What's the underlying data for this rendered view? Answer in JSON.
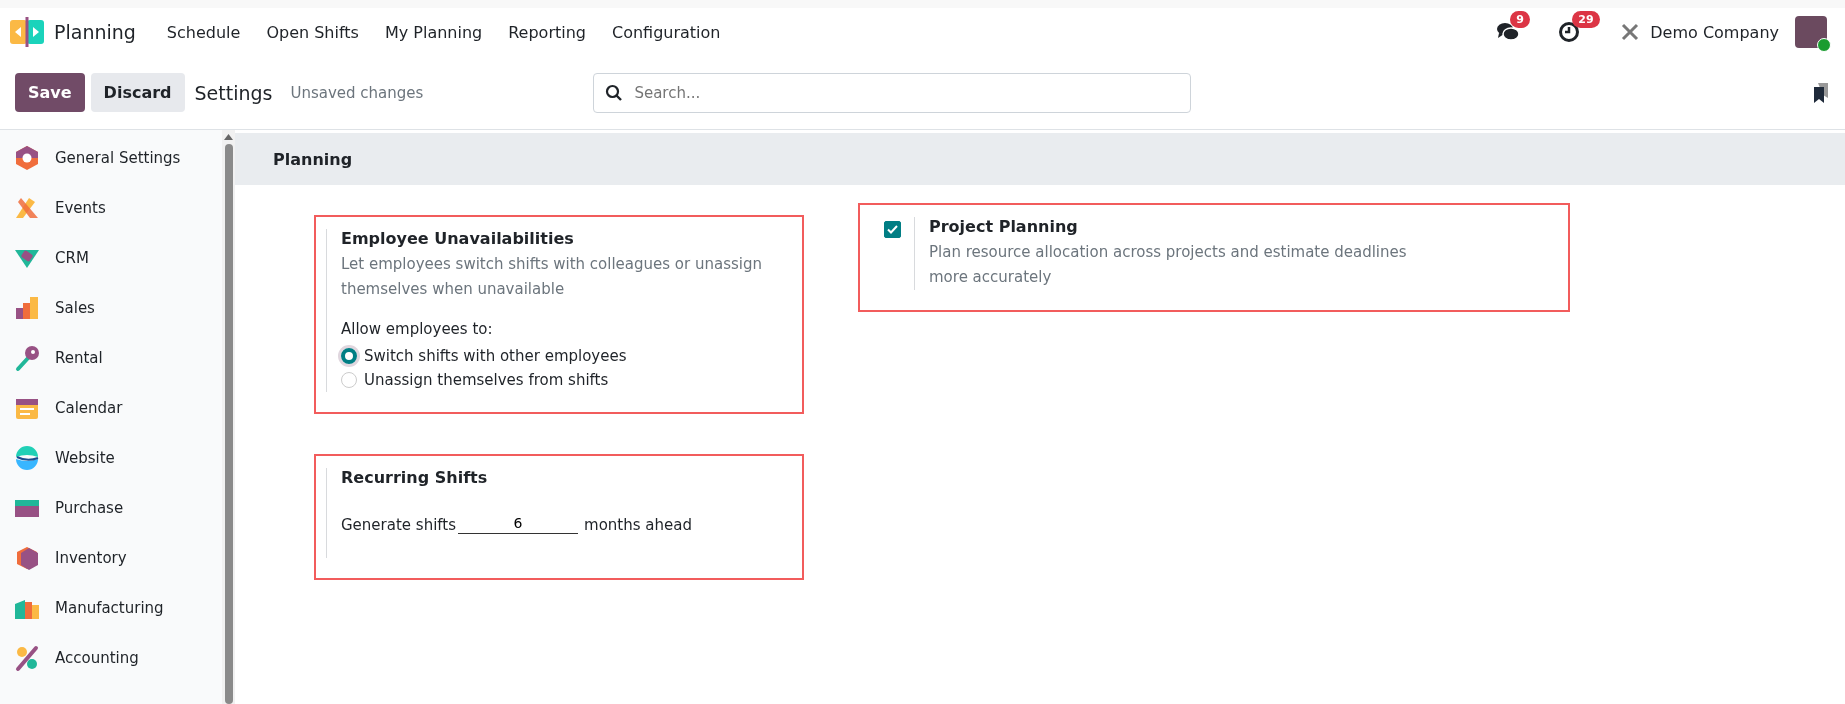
{
  "app": {
    "name": "Planning"
  },
  "menu": [
    {
      "label": "Schedule"
    },
    {
      "label": "Open Shifts"
    },
    {
      "label": "My Planning"
    },
    {
      "label": "Reporting"
    },
    {
      "label": "Configuration"
    }
  ],
  "systray": {
    "messages_count": "9",
    "activities_count": "29",
    "company": "Demo Company",
    "avatar_online": true
  },
  "control_panel": {
    "save": "Save",
    "discard": "Discard",
    "title": "Settings",
    "status": "Unsaved changes",
    "search": {
      "placeholder": "Search..."
    }
  },
  "sidebar": {
    "items": [
      {
        "label": "General Settings",
        "kind": "settings"
      },
      {
        "label": "Events",
        "kind": "events"
      },
      {
        "label": "CRM",
        "kind": "crm"
      },
      {
        "label": "Sales",
        "kind": "sales"
      },
      {
        "label": "Rental",
        "kind": "rental"
      },
      {
        "label": "Calendar",
        "kind": "calendar"
      },
      {
        "label": "Website",
        "kind": "website"
      },
      {
        "label": "Purchase",
        "kind": "purchase"
      },
      {
        "label": "Inventory",
        "kind": "inventory"
      },
      {
        "label": "Manufacturing",
        "kind": "manufacturing"
      },
      {
        "label": "Accounting",
        "kind": "accounting"
      }
    ]
  },
  "section": {
    "title": "Planning",
    "settings": [
      {
        "kind": "radio",
        "highlighted": true,
        "title": "Employee Unavailabilities",
        "description": "Let employees switch shifts with colleagues or unassign themselves when unavailable",
        "label": "Allow employees to:",
        "options": [
          {
            "label": "Switch shifts with other employees",
            "selected": true
          },
          {
            "label": "Unassign themselves from shifts",
            "selected": false
          }
        ]
      },
      {
        "kind": "checkbox",
        "highlighted": true,
        "checked": true,
        "title": "Project Planning",
        "description": "Plan resource allocation across projects and estimate deadlines more accurately"
      },
      {
        "kind": "number",
        "highlighted": true,
        "title": "Recurring Shifts",
        "prefix": "Generate shifts",
        "value": "6",
        "suffix": "months ahead"
      }
    ]
  }
}
